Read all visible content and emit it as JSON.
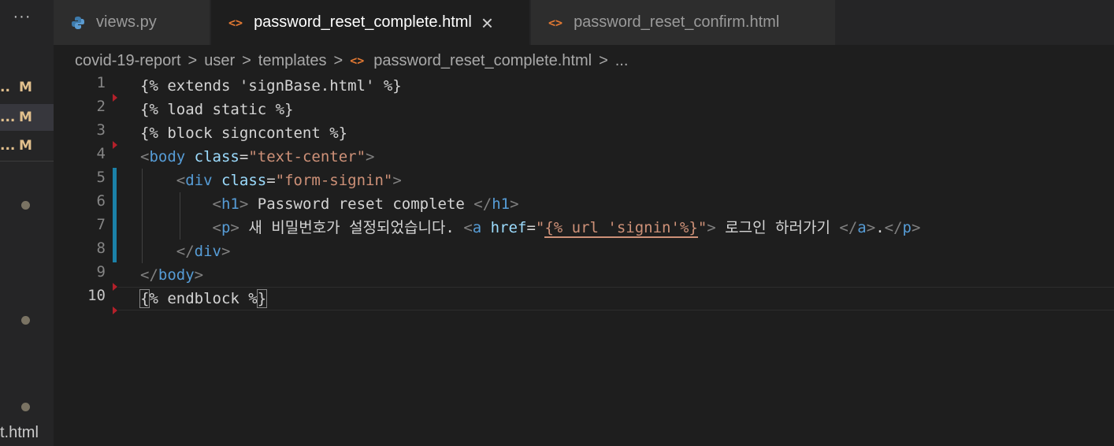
{
  "sidebar": {
    "more_label": "···",
    "modified_rows": [
      {
        "dots": "..",
        "badge": "M"
      },
      {
        "dots": "...",
        "badge": "M"
      },
      {
        "dots": "...",
        "badge": "M"
      }
    ],
    "partial_filename": "t.html"
  },
  "tabs": [
    {
      "label": "views.py",
      "icon": "python-icon",
      "active": false
    },
    {
      "label": "password_reset_complete.html",
      "icon": "html-icon",
      "active": true,
      "close_label": "×"
    },
    {
      "label": "password_reset_confirm.html",
      "icon": "html-icon",
      "active": false
    }
  ],
  "html_icon_glyph": "<>",
  "breadcrumb": {
    "items": [
      "covid-19-report",
      "user",
      "templates",
      "password_reset_complete.html",
      "..."
    ],
    "separator": ">"
  },
  "editor": {
    "line_numbers": [
      "1",
      "2",
      "3",
      "4",
      "5",
      "6",
      "7",
      "8",
      "9",
      "10"
    ],
    "current_line": 10,
    "text": {
      "l1": "{% extends 'signBase.html' %}",
      "l2": "{% load static %}",
      "l3": "{% block signcontent %}",
      "body_tag": "body",
      "class_attr": "class",
      "body_class_val": "\"text-center\"",
      "div_tag": "div",
      "div_class_val": "\"form-signin\"",
      "h1_tag": "h1",
      "h1_text": " Password reset complete ",
      "p_tag": "p",
      "p_text": " 새 비밀번호가 설정되었습니다. ",
      "a_tag": "a",
      "href_attr": "href",
      "href_q": "\"",
      "href_val": "{% url 'signin'%}",
      "a_text": " 로그인 하러가기 ",
      "period": ".",
      "endblock_open": "{",
      "endblock_mid": "% endblock %",
      "endblock_close": "}"
    }
  },
  "colors": {
    "background": "#1e1e1e",
    "tag": "#569cd6",
    "attribute": "#9cdcfe",
    "string": "#ce9178",
    "modified_badge": "#e2c08d",
    "html_icon": "#e37933"
  }
}
